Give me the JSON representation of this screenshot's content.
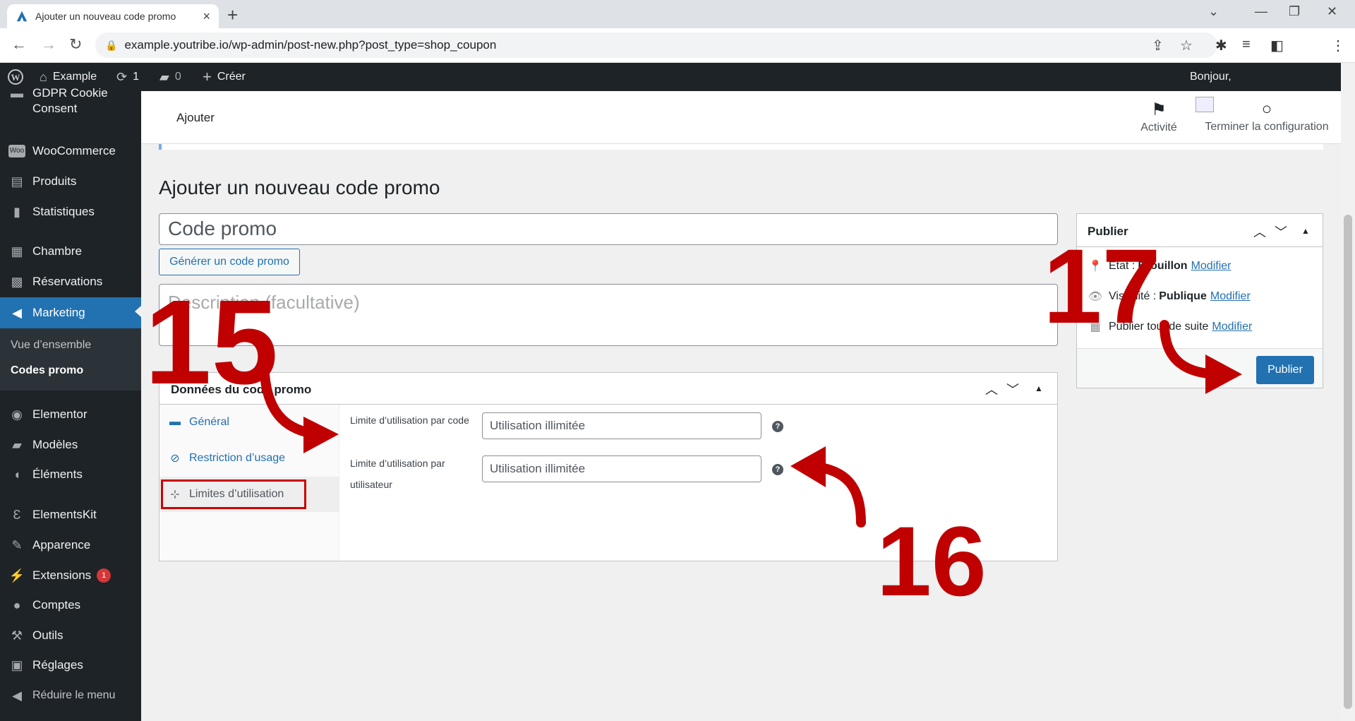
{
  "browser": {
    "tab_title": "Ajouter un nouveau code promo",
    "tab_close": "×",
    "new_tab": "+",
    "url": "example.youtribe.io/wp-admin/post-new.php?post_type=shop_coupon"
  },
  "adminbar": {
    "site_name": "Example",
    "updates_count": "1",
    "comments_count": "0",
    "create_label": "Créer",
    "greeting": "Bonjour,"
  },
  "sidebar": {
    "items": [
      {
        "label": "GDPR Cookie Consent",
        "icon": "cookie-icon"
      },
      {
        "label": "WooCommerce",
        "icon": "woo-icon"
      },
      {
        "label": "Produits",
        "icon": "archive-icon"
      },
      {
        "label": "Statistiques",
        "icon": "chart-bar-icon"
      },
      {
        "label": "Chambre",
        "icon": "building-icon"
      },
      {
        "label": "Réservations",
        "icon": "calendar-icon"
      },
      {
        "label": "Marketing",
        "icon": "megaphone-icon"
      },
      {
        "label": "Elementor",
        "icon": "elementor-icon"
      },
      {
        "label": "Modèles",
        "icon": "folder-icon"
      },
      {
        "label": "Éléments",
        "icon": "drop-icon"
      },
      {
        "label": "ElementsKit",
        "icon": "ekit-icon"
      },
      {
        "label": "Apparence",
        "icon": "brush-icon"
      },
      {
        "label": "Extensions",
        "icon": "plugin-icon",
        "badge": "1"
      },
      {
        "label": "Comptes",
        "icon": "user-icon"
      },
      {
        "label": "Outils",
        "icon": "wrench-icon"
      },
      {
        "label": "Réglages",
        "icon": "settings-icon"
      },
      {
        "label": "Réduire le menu",
        "icon": "collapse-icon"
      }
    ],
    "submenu": [
      "Vue d’ensemble",
      "Codes promo"
    ]
  },
  "wc_header": {
    "title": "Ajouter",
    "activity": "Activité",
    "setup": "Terminer la configuration"
  },
  "main": {
    "page_title": "Ajouter un nouveau code promo",
    "code_placeholder": "Code promo",
    "generate_button": "Générer un code promo",
    "description_placeholder": "Description (facultative)"
  },
  "coupon_panel": {
    "title": "Données du code promo",
    "tabs": [
      "Général",
      "Restriction d’usage",
      "Limites d’utilisation"
    ],
    "fields": [
      {
        "label": "Limite d’utilisation par code",
        "placeholder": "Utilisation illimitée"
      },
      {
        "label_line1": "Limite d’utilisation par",
        "label_line2": "utilisateur",
        "placeholder": "Utilisation illimitée"
      }
    ]
  },
  "publish": {
    "title": "Publier",
    "status_label": "État :",
    "status_value": "Brouillon",
    "visibility_label": "Visibilité :",
    "visibility_value": "Publique",
    "schedule": "Publier tout de suite",
    "modify": "Modifier",
    "button": "Publier"
  },
  "annotations": {
    "step1": "15",
    "step2": "16",
    "step3": "17",
    "color": "#c00000"
  },
  "colors": {
    "accent": "#2271b1",
    "adminbar": "#1d2327",
    "annotation": "#c00000"
  }
}
